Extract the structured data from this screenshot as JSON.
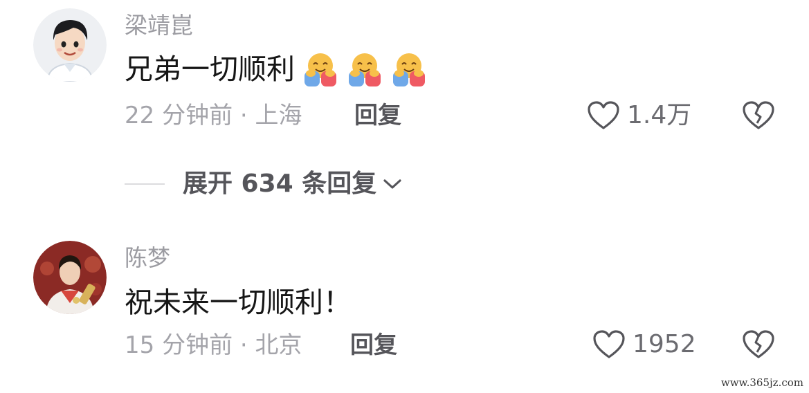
{
  "comments": [
    {
      "username": "梁靖崑",
      "text": "兄弟一切顺利",
      "emoji": [
        "hugging-face-icon",
        "hugging-face-icon",
        "hugging-face-icon"
      ],
      "time": "22 分钟前 · 上海",
      "reply_label": "回复",
      "likes": "1.4万"
    },
    {
      "username": "陈梦",
      "text": "祝未来一切顺利！",
      "time": "15 分钟前 · 北京",
      "reply_label": "回复",
      "likes": "1952"
    }
  ],
  "expand_replies": {
    "label": "展开 634 条回复"
  },
  "watermark": "www.365jz.com",
  "colors": {
    "muted": "#9c9ca2",
    "text": "#161616",
    "icon": "#6b6b70"
  }
}
